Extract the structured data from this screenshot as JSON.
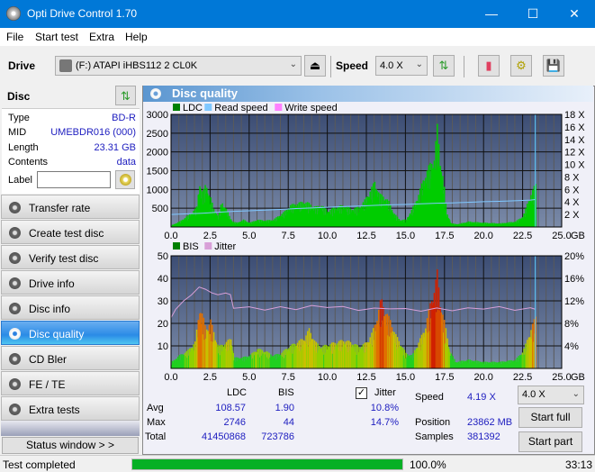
{
  "window": {
    "title": "Opti Drive Control 1.70",
    "minimize": "—",
    "maximize": "☐",
    "close": "✕"
  },
  "menu": [
    "File",
    "Start test",
    "Extra",
    "Help"
  ],
  "toolbar": {
    "drive_label": "Drive",
    "drive_value": "(F:)  ATAPI iHBS112   2 CL0K",
    "speed_label": "Speed",
    "speed_value": "4.0 X",
    "icons": [
      "eject-icon",
      "refresh-icon",
      "erase-icon",
      "settings-icon",
      "save-icon"
    ]
  },
  "disc": {
    "header": "Disc",
    "rows": [
      {
        "key": "Type",
        "value": "BD-R"
      },
      {
        "key": "MID",
        "value": "UMEBDR016 (000)"
      },
      {
        "key": "Length",
        "value": "23.31 GB"
      },
      {
        "key": "Contents",
        "value": "data"
      }
    ],
    "label_key": "Label",
    "label_value": ""
  },
  "sidebar": {
    "items": [
      {
        "label": "Transfer rate",
        "active": false
      },
      {
        "label": "Create test disc",
        "active": false
      },
      {
        "label": "Verify test disc",
        "active": false
      },
      {
        "label": "Drive info",
        "active": false
      },
      {
        "label": "Disc info",
        "active": false
      },
      {
        "label": "Disc quality",
        "active": true
      },
      {
        "label": "CD Bler",
        "active": false
      },
      {
        "label": "FE / TE",
        "active": false
      },
      {
        "label": "Extra tests",
        "active": false
      }
    ],
    "status_window": "Status window > >"
  },
  "panel": {
    "title": "Disc quality"
  },
  "chart_data": [
    {
      "type": "area",
      "title": "LDC",
      "legend": [
        "LDC",
        "Read speed",
        "Write speed"
      ],
      "legend_colors": [
        "#008000",
        "#80c8ff",
        "#ff80ff"
      ],
      "xlabel": "GB",
      "x_ticks": [
        "0.0",
        "2.5",
        "5.0",
        "7.5",
        "10.0",
        "12.5",
        "15.0",
        "17.5",
        "20.0",
        "22.5",
        "25.0"
      ],
      "xlim": [
        0,
        25
      ],
      "ylim": [
        0,
        3000
      ],
      "y_ticks": [
        "500",
        "1000",
        "1500",
        "2000",
        "2500",
        "3000"
      ],
      "y2lim": [
        0,
        18
      ],
      "y2_ticks": [
        "2 X",
        "4 X",
        "6 X",
        "8 X",
        "10 X",
        "12 X",
        "14 X",
        "16 X",
        "18 X"
      ],
      "series": [
        {
          "name": "LDC",
          "x": [
            0,
            0.5,
            1,
            1.3,
            1.6,
            1.8,
            1.9,
            2.0,
            2.2,
            2.4,
            2.5,
            2.7,
            3.0,
            3.2,
            3.5,
            3.7,
            3.9,
            4.2,
            4.6,
            5.0,
            5.5,
            6.0,
            6.5,
            7.0,
            7.3,
            7.6,
            8.0,
            8.5,
            8.8,
            9.2,
            9.6,
            10.0,
            10.5,
            11.0,
            11.5,
            12.0,
            12.3,
            12.7,
            13.0,
            13.3,
            13.6,
            13.9,
            14.2,
            14.6,
            15.0,
            15.4,
            15.8,
            16.1,
            16.5,
            16.8,
            17.0,
            17.2,
            17.4,
            17.6,
            17.9,
            18.3,
            19.0,
            20.0,
            21.0,
            22.0,
            22.5,
            22.8,
            23.1,
            23.3
          ],
          "values": [
            50,
            150,
            300,
            400,
            550,
            1250,
            1000,
            950,
            1200,
            900,
            800,
            500,
            300,
            700,
            500,
            300,
            150,
            120,
            200,
            120,
            200,
            180,
            200,
            350,
            450,
            600,
            650,
            700,
            650,
            550,
            600,
            450,
            550,
            600,
            500,
            550,
            700,
            1000,
            1250,
            900,
            850,
            700,
            400,
            200,
            200,
            500,
            900,
            1300,
            1700,
            1900,
            2750,
            1800,
            1300,
            400,
            100,
            80,
            150,
            120,
            100,
            150,
            300,
            700,
            1000,
            1200
          ]
        },
        {
          "name": "Read speed",
          "x": [
            0,
            1,
            2,
            3,
            4,
            5,
            6,
            7,
            8,
            9,
            10,
            11,
            12,
            13,
            14,
            15,
            16,
            17,
            18,
            19,
            20,
            21,
            22,
            23,
            23.31
          ],
          "values": [
            2.0,
            2.1,
            2.2,
            2.35,
            2.5,
            2.6,
            2.7,
            2.8,
            2.95,
            3.05,
            3.15,
            3.25,
            3.35,
            3.45,
            3.55,
            3.6,
            3.7,
            3.8,
            3.85,
            3.95,
            4.05,
            4.1,
            4.2,
            4.3,
            4.4
          ]
        }
      ]
    },
    {
      "type": "bar",
      "title": "BIS",
      "legend": [
        "BIS",
        "Jitter"
      ],
      "legend_colors": [
        "#008000",
        "#d8a0d8"
      ],
      "xlabel": "GB",
      "x_ticks": [
        "0.0",
        "2.5",
        "5.0",
        "7.5",
        "10.0",
        "12.5",
        "15.0",
        "17.5",
        "20.0",
        "22.5",
        "25.0"
      ],
      "xlim": [
        0,
        25
      ],
      "ylim": [
        0,
        50
      ],
      "y_ticks": [
        "10",
        "20",
        "30",
        "40",
        "50"
      ],
      "y2lim": [
        0,
        20
      ],
      "y2_ticks": [
        "4%",
        "8%",
        "12%",
        "16%",
        "20%"
      ],
      "series": [
        {
          "name": "BIS",
          "x": [
            0,
            0.5,
            1,
            1.5,
            1.8,
            2.0,
            2.2,
            2.5,
            2.8,
            3.0,
            3.5,
            3.8,
            4.0,
            4.5,
            5.0,
            5.5,
            6.0,
            6.5,
            7.0,
            7.5,
            8.0,
            8.5,
            8.8,
            9.2,
            9.6,
            10.0,
            10.5,
            11.0,
            11.5,
            12.0,
            12.5,
            12.8,
            13.1,
            13.4,
            13.7,
            14.0,
            14.3,
            14.6,
            15.0,
            15.4,
            15.8,
            16.2,
            16.5,
            16.8,
            17.0,
            17.2,
            17.5,
            17.8,
            18.2,
            19.0,
            20.0,
            21.0,
            22.0,
            22.5,
            22.8,
            23.1,
            23.3
          ],
          "values": [
            3,
            6,
            8,
            12,
            28,
            24,
            18,
            22,
            14,
            10,
            12,
            14,
            5,
            5,
            6,
            9,
            8,
            6,
            7,
            10,
            12,
            14,
            18,
            12,
            10,
            11,
            12,
            13,
            12,
            10,
            12,
            16,
            22,
            32,
            26,
            22,
            16,
            12,
            7,
            6,
            12,
            18,
            28,
            36,
            44,
            30,
            20,
            8,
            3,
            4,
            3,
            3,
            4,
            8,
            14,
            20,
            24
          ]
        },
        {
          "name": "Jitter",
          "x": [
            0,
            0.3,
            0.8,
            1.3,
            1.8,
            2.2,
            2.6,
            3.0,
            3.5,
            3.8,
            4.0,
            5.0,
            6.0,
            7.0,
            8.0,
            9.0,
            10.0,
            11.0,
            12.0,
            13.0,
            14.0,
            15.0,
            16.0,
            17.0,
            18.0,
            19.0,
            20.0,
            21.0,
            22.0,
            23.0,
            23.3
          ],
          "values": [
            9.0,
            10.5,
            12.0,
            13.0,
            14.5,
            14.0,
            13.5,
            13.0,
            13.5,
            13.0,
            10.8,
            10.8,
            10.5,
            10.8,
            10.6,
            11.0,
            11.0,
            10.8,
            10.5,
            10.5,
            10.8,
            10.4,
            10.4,
            10.5,
            10.5,
            10.5,
            10.8,
            10.7,
            10.6,
            10.5,
            10.8
          ]
        }
      ]
    }
  ],
  "stats": {
    "headers": [
      "LDC",
      "BIS"
    ],
    "rows": [
      {
        "label": "Avg",
        "ldc": "108.57",
        "bis": "1.90",
        "jitter": "10.8%"
      },
      {
        "label": "Max",
        "ldc": "2746",
        "bis": "44",
        "jitter": "14.7%"
      },
      {
        "label": "Total",
        "ldc": "41450868",
        "bis": "723786",
        "jitter": ""
      }
    ],
    "jitter_label": "Jitter",
    "jitter_checked": true,
    "speed_label": "Speed",
    "speed_value": "4.19 X",
    "position_label": "Position",
    "position_value": "23862 MB",
    "samples_label": "Samples",
    "samples_value": "381392",
    "speed_select": "4.0 X",
    "start_full": "Start full",
    "start_part": "Start part"
  },
  "statusbar": {
    "text": "Test completed",
    "progress": 100.0,
    "progress_text": "100.0%",
    "time": "33:13"
  }
}
